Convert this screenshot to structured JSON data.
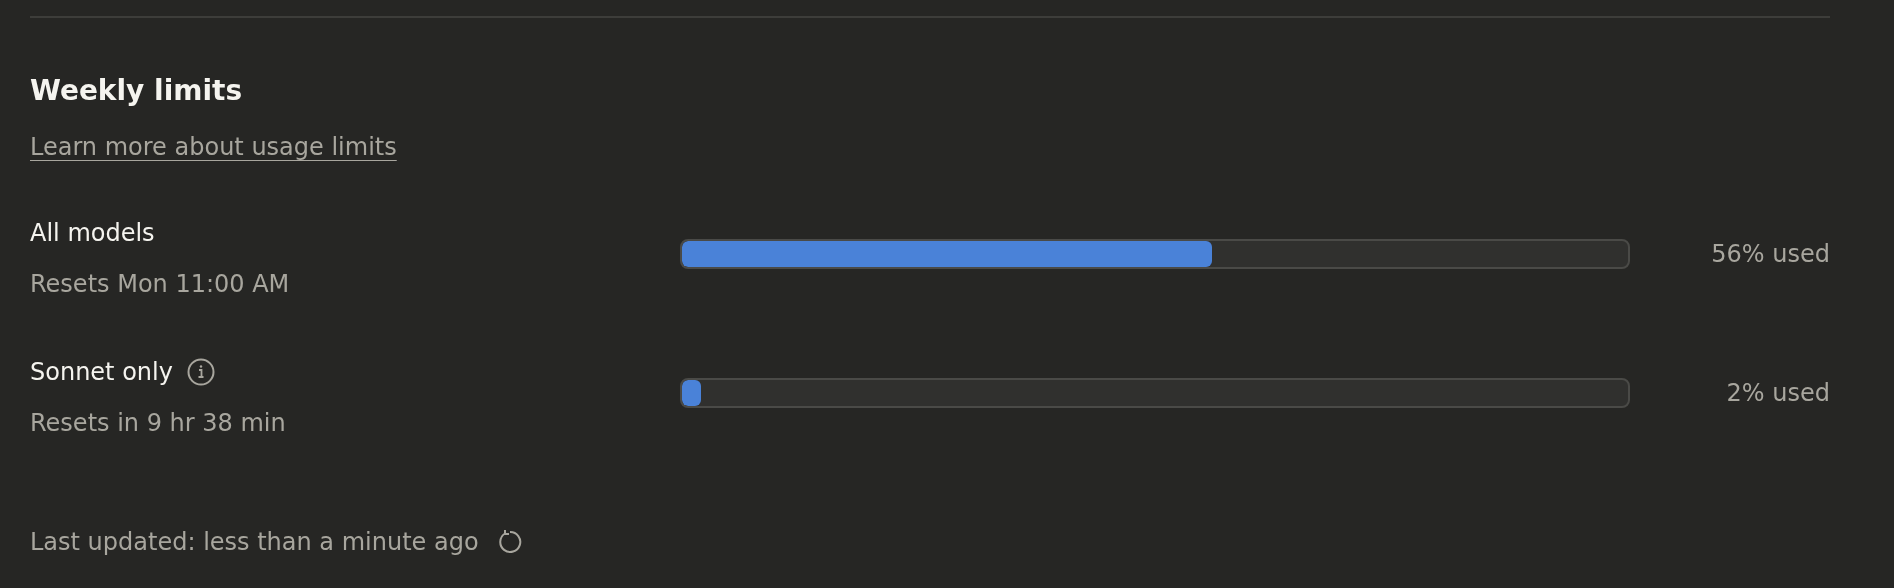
{
  "section": {
    "title": "Weekly limits",
    "link": "Learn more about usage limits"
  },
  "limits": [
    {
      "name": "All models",
      "info": false,
      "reset": "Resets Mon 11:00 AM",
      "level": 0.56,
      "reading": "56% used"
    },
    {
      "name": "Sonnet only",
      "info": true,
      "reset": "Resets in 9 hr 38 min",
      "level": 0.02,
      "reading": "2% used"
    }
  ],
  "footer": {
    "text": "Last updated: less than a minute ago"
  }
}
